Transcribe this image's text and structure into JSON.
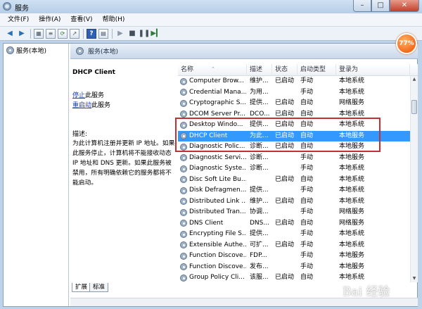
{
  "window": {
    "title": "服务",
    "minimize": "–",
    "maximize": "□",
    "close": "✕"
  },
  "menu": {
    "file": "文件(F)",
    "action": "操作(A)",
    "view": "查看(V)",
    "help": "帮助(H)"
  },
  "toolbar_icons": [
    "back-icon",
    "forward-icon",
    "console-tree-icon",
    "list-icon",
    "refresh-icon",
    "export-icon",
    "help-icon",
    "properties-icon",
    "play-icon",
    "stop-icon",
    "pause-icon",
    "restart-icon"
  ],
  "tree": {
    "root_label": "服务(本地)"
  },
  "content_header": {
    "title": "服务(本地)"
  },
  "details": {
    "service_name": "DHCP Client",
    "stop_link_verb": "停止",
    "stop_link_rest": "此服务",
    "restart_link_verb": "重启动",
    "restart_link_rest": "此服务",
    "description_label": "描述:",
    "description_text": "为此计算机注册并更新 IP 地址。如果\n此服务停止，计算机将不能接收动态\nIP 地址和 DNS 更新。如果此服务被\n禁用，所有明确依赖它的服务都将不\n能启动。"
  },
  "table": {
    "columns": {
      "name": "名称",
      "description": "描述",
      "status": "状态",
      "startup": "启动类型",
      "logon": "登录为"
    },
    "selected_index": 5,
    "rows": [
      {
        "name": "Computer Brow...",
        "description": "维护...",
        "status": "已启动",
        "startup": "手动",
        "logon": "本地系统"
      },
      {
        "name": "Credential Mana...",
        "description": "为用...",
        "status": "",
        "startup": "手动",
        "logon": "本地系统"
      },
      {
        "name": "Cryptographic S...",
        "description": "提供...",
        "status": "已启动",
        "startup": "自动",
        "logon": "网络服务"
      },
      {
        "name": "DCOM Server Pr...",
        "description": "DCO...",
        "status": "已启动",
        "startup": "自动",
        "logon": "本地系统"
      },
      {
        "name": "Desktop Windo...",
        "description": "提供...",
        "status": "已启动",
        "startup": "自动",
        "logon": "本地系统"
      },
      {
        "name": "DHCP Client",
        "description": "为此...",
        "status": "已启动",
        "startup": "自动",
        "logon": "本地服务"
      },
      {
        "name": "Diagnostic Polic...",
        "description": "诊断...",
        "status": "已启动",
        "startup": "自动",
        "logon": "本地服务"
      },
      {
        "name": "Diagnostic Servi...",
        "description": "诊断...",
        "status": "",
        "startup": "手动",
        "logon": "本地服务"
      },
      {
        "name": "Diagnostic Syste...",
        "description": "诊断...",
        "status": "",
        "startup": "手动",
        "logon": "本地系统"
      },
      {
        "name": "Disc Soft Lite Bu...",
        "description": "",
        "status": "已启动",
        "startup": "自动",
        "logon": "本地系统"
      },
      {
        "name": "Disk Defragmen...",
        "description": "提供...",
        "status": "",
        "startup": "手动",
        "logon": "本地系统"
      },
      {
        "name": "Distributed Link ...",
        "description": "维护...",
        "status": "已启动",
        "startup": "自动",
        "logon": "本地系统"
      },
      {
        "name": "Distributed Tran...",
        "description": "协调...",
        "status": "",
        "startup": "手动",
        "logon": "网络服务"
      },
      {
        "name": "DNS Client",
        "description": "DNS...",
        "status": "已启动",
        "startup": "自动",
        "logon": "网络服务"
      },
      {
        "name": "Encrypting File S...",
        "description": "提供...",
        "status": "",
        "startup": "手动",
        "logon": "本地系统"
      },
      {
        "name": "Extensible Authe...",
        "description": "可扩...",
        "status": "已启动",
        "startup": "手动",
        "logon": "本地系统"
      },
      {
        "name": "Function Discove...",
        "description": "FDP...",
        "status": "",
        "startup": "手动",
        "logon": "本地服务"
      },
      {
        "name": "Function Discove...",
        "description": "发布...",
        "status": "",
        "startup": "手动",
        "logon": "本地服务"
      },
      {
        "name": "Group Policy Cli...",
        "description": "该服...",
        "status": "已启动",
        "startup": "自动",
        "logon": "本地系统"
      }
    ]
  },
  "tabs": {
    "extended": "扩展",
    "standard": "标准"
  },
  "badge": {
    "text": "77%"
  },
  "watermark": {
    "text": "Bai 经验"
  },
  "scrollbar": {
    "up": "▲",
    "down": "▼",
    "sort": "⌃"
  }
}
